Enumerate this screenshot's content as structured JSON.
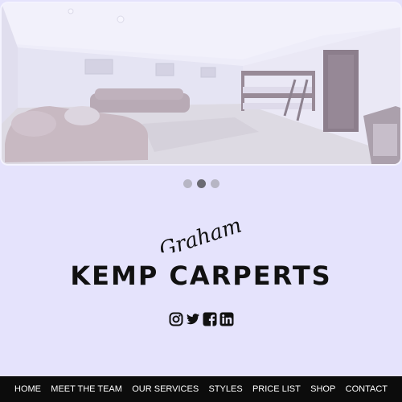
{
  "hero": {
    "image": "living-room-carpet-photo",
    "slides": [
      {
        "label": "slide-1",
        "active": false
      },
      {
        "label": "slide-2",
        "active": true
      },
      {
        "label": "slide-3",
        "active": false
      }
    ]
  },
  "brand": {
    "script_text": "Graham",
    "name": "KEMP CARPERTS"
  },
  "social": [
    {
      "icon": "instagram-icon"
    },
    {
      "icon": "twitter-icon"
    },
    {
      "icon": "facebook-icon"
    },
    {
      "icon": "linkedin-icon"
    }
  ],
  "nav": {
    "items": [
      "HOME",
      "MEET THE TEAM",
      "OUR SERVICES",
      "STYLES",
      "PRICE LIST",
      "SHOP",
      "CONTACT"
    ]
  },
  "colors": {
    "background": "#e5e3fc",
    "nav_background": "#0c0c0c",
    "dot_active": "#6b6b73",
    "dot_inactive": "#b7b6c4"
  }
}
